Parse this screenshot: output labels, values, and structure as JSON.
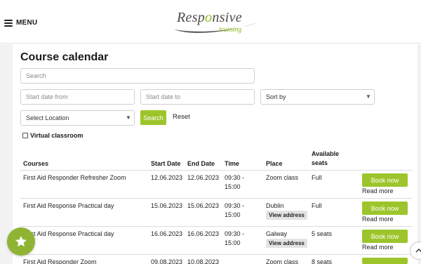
{
  "header": {
    "menu_label": "MENU",
    "logo": {
      "prefix": "Resp",
      "accent": "o",
      "suffix": "nsive",
      "tagline": "training"
    }
  },
  "page": {
    "title": "Course calendar",
    "search_placeholder": "Search",
    "start_from_placeholder": "Start date from",
    "start_to_placeholder": "Start date to",
    "sort_by": "Sort by",
    "location": "Select Location",
    "search_button": "Search",
    "reset_label": "Reset",
    "virtual_label": "Virtual classroom"
  },
  "table": {
    "headers": {
      "courses": "Courses",
      "start_date": "Start Date",
      "end_date": "End Date",
      "time": "Time",
      "place": "Place",
      "available_1": "Available",
      "available_2": "seats"
    },
    "rows": [
      {
        "course": "First Aid Responder Refresher Zoom",
        "start": "12.06.2023",
        "end": "12.06.2023",
        "time_1": "09:30 -",
        "time_2": "15:00",
        "place": "Zoom class",
        "view_address": "",
        "seats": "Full",
        "book": "Book now",
        "read_more": "Read more"
      },
      {
        "course": "First Aid Response Practical day",
        "start": "15.06.2023",
        "end": "15.06.2023",
        "time_1": "09:30 -",
        "time_2": "15:00",
        "place": "Dublin",
        "view_address": "View address",
        "seats": "Full",
        "book": "Book now",
        "read_more": "Read more"
      },
      {
        "course": "First Aid Response Practical day",
        "start": "16.06.2023",
        "end": "16.06.2023",
        "time_1": "09:30 -",
        "time_2": "15:00",
        "place": "Galway",
        "view_address": "View address",
        "seats": "5 seats",
        "book": "Book now",
        "read_more": "Read more"
      },
      {
        "course": "First Aid Responder Zoom",
        "start": "09.08.2023",
        "end": "10.08.2023",
        "time_1": "",
        "time_2": "",
        "place": "Zoom class",
        "view_address": "",
        "seats": "8 seats",
        "book": "",
        "read_more": ""
      }
    ]
  },
  "colors": {
    "accent": "#9dc52b",
    "logo_accent": "#8cbb1b",
    "fab": "#8fb434"
  },
  "icons": {
    "menu": "hamburger-icon",
    "favorite": "star-icon",
    "scroll_top": "chevron-up-icon"
  }
}
